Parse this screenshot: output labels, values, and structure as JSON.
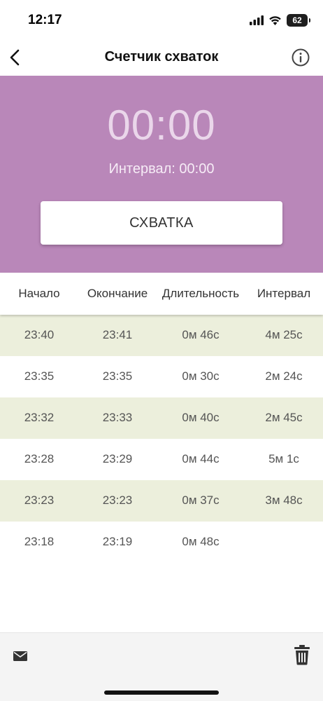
{
  "status_bar": {
    "time": "12:17",
    "battery": "62",
    "icons": [
      "signal-icon",
      "wifi-icon",
      "battery-icon"
    ]
  },
  "nav": {
    "title": "Счетчик схваток",
    "back_icon": "chevron-left-icon",
    "info_icon": "info-icon"
  },
  "timer_panel": {
    "timer": "00:00",
    "interval": "Интервал: 00:00",
    "button_label": "СХВАТКА",
    "background_color": "#b987b9"
  },
  "table": {
    "headers": [
      "Начало",
      "Окончание",
      "Длительность",
      "Интервал"
    ],
    "rows": [
      {
        "start": "23:40",
        "end": "23:41",
        "duration": "0м 46с",
        "interval": "4м 25с"
      },
      {
        "start": "23:35",
        "end": "23:35",
        "duration": "0м 30с",
        "interval": "2м 24с"
      },
      {
        "start": "23:32",
        "end": "23:33",
        "duration": "0м 40с",
        "interval": "2м 45с"
      },
      {
        "start": "23:28",
        "end": "23:29",
        "duration": "0м 44с",
        "interval": "5м 1с"
      },
      {
        "start": "23:23",
        "end": "23:23",
        "duration": "0м 37с",
        "interval": "3м 48с"
      },
      {
        "start": "23:18",
        "end": "23:19",
        "duration": "0м 48с",
        "interval": ""
      }
    ],
    "alt_row_color": "#ecefdc"
  },
  "toolbar": {
    "mail_icon": "mail-icon",
    "trash_icon": "trash-icon"
  }
}
